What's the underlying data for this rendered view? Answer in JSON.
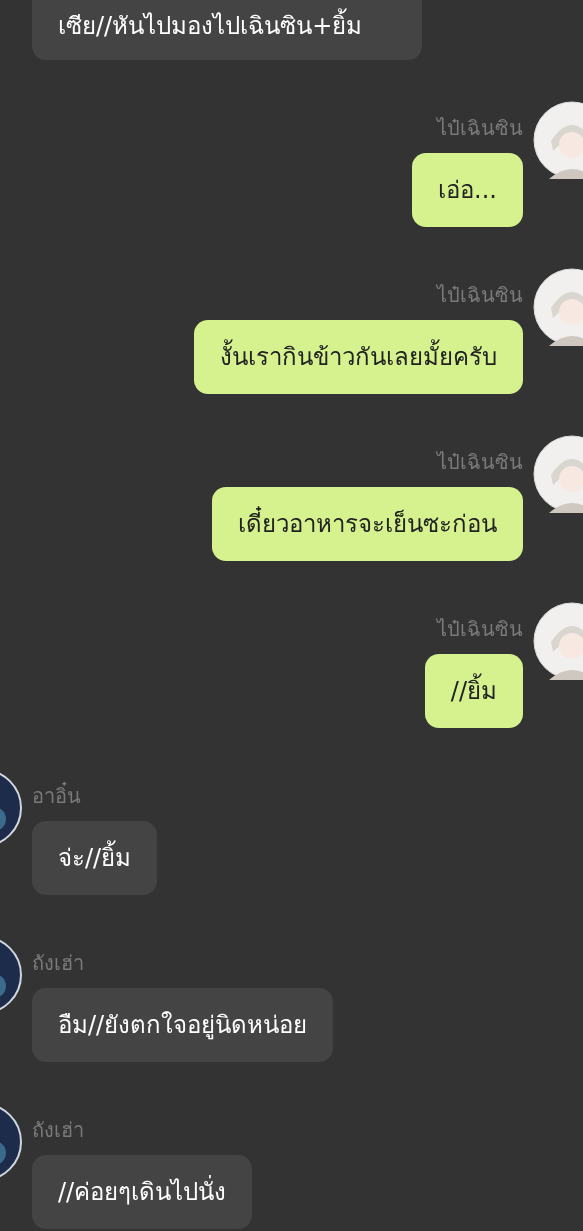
{
  "messages": [
    {
      "kind": "incoming",
      "text": "เซีย//หันไปมองไปเฉินซิน+ยิ้ม"
    },
    {
      "kind": "outgoing",
      "name": "ไป๋เฉินซิน",
      "text": "เอ่อ..."
    },
    {
      "kind": "outgoing",
      "name": "ไป๋เฉินซิน",
      "text": "งั้นเรากินข้าวกันเลยมั้ยครับ"
    },
    {
      "kind": "outgoing",
      "name": "ไป๋เฉินซิน",
      "text": "เดี๋ยวอาหารจะเย็นซะก่อน"
    },
    {
      "kind": "outgoing",
      "name": "ไป๋เฉินซิน",
      "text": "//ยิ้ม"
    },
    {
      "kind": "incoming",
      "name": "อาอิ๋น",
      "text": "จ่ะ//ยิ้ม"
    },
    {
      "kind": "incoming",
      "name": "ถังเฮ่า",
      "text": "อืม//ยังตกใจอยู่นิดหน่อย"
    },
    {
      "kind": "incoming",
      "name": "ถังเฮ่า",
      "text": "//ค่อยๆเดินไปนั่ง"
    }
  ]
}
